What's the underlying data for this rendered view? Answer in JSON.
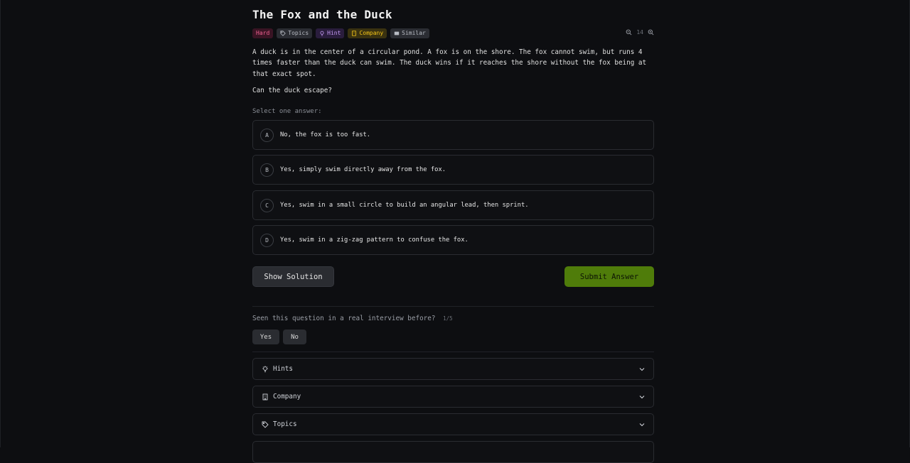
{
  "problem": {
    "title": "The Fox and the Duck",
    "description": "A duck is in the center of a circular pond. A fox is on the shore. The fox cannot swim, but runs 4 times faster than the duck can swim. The duck wins if it reaches the shore without the fox being at that exact spot.",
    "question": "Can the duck escape?"
  },
  "tags": {
    "difficulty": "Hard",
    "topics": "Topics",
    "hint": "Hint",
    "company": "Company",
    "similar": "Similar"
  },
  "zoom": {
    "level": "14"
  },
  "answers": {
    "prompt": "Select one answer:",
    "options": [
      {
        "letter": "A",
        "text": "No, the fox is too fast."
      },
      {
        "letter": "B",
        "text": "Yes, simply swim directly away from the fox."
      },
      {
        "letter": "C",
        "text": "Yes, swim in a small circle to build an angular lead, then sprint."
      },
      {
        "letter": "D",
        "text": "Yes, swim in a zig-zag pattern to confuse the fox."
      }
    ]
  },
  "actions": {
    "show_solution": "Show Solution",
    "submit": "Submit Answer"
  },
  "feedback": {
    "question": "Seen this question in a real interview before?",
    "count": "1/5",
    "yes": "Yes",
    "no": "No"
  },
  "sections": [
    {
      "label": "Hints",
      "icon": "lightbulb-icon"
    },
    {
      "label": "Company",
      "icon": "building-icon"
    },
    {
      "label": "Topics",
      "icon": "tag-icon"
    }
  ],
  "colors": {
    "background": "#0d0e11",
    "accent_submit": "#4f7c0a",
    "hard": "#f06292",
    "hint": "#c69cf5",
    "company": "#f5c518"
  }
}
